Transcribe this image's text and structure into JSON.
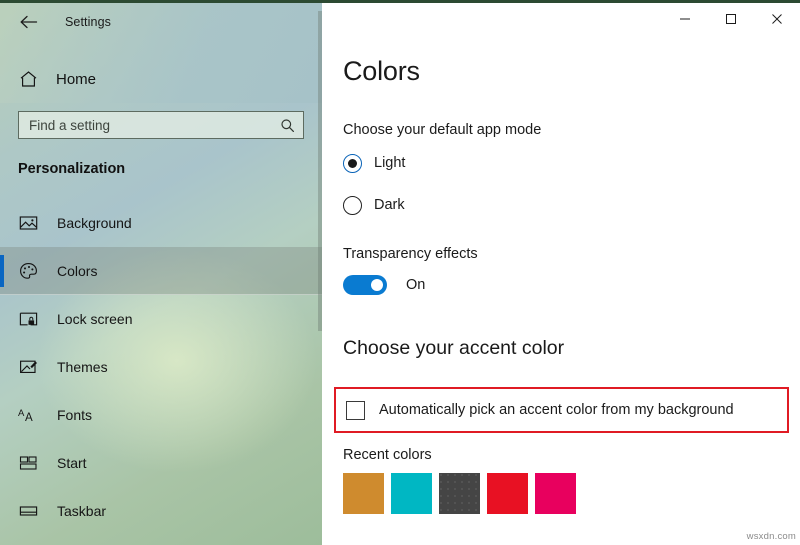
{
  "window": {
    "title": "Settings",
    "back_icon": "back-arrow-icon",
    "controls": {
      "minimize_label": "—",
      "maximize_label": "☐",
      "close_label": "✕"
    }
  },
  "sidebar": {
    "home": {
      "label": "Home",
      "icon": "home-icon"
    },
    "search": {
      "value": "",
      "placeholder": "Find a setting",
      "icon": "search-icon"
    },
    "section_title": "Personalization",
    "items": [
      {
        "label": "Background",
        "icon": "image-icon",
        "selected": false
      },
      {
        "label": "Colors",
        "icon": "palette-icon",
        "selected": true
      },
      {
        "label": "Lock screen",
        "icon": "lock-screen-icon",
        "selected": false
      },
      {
        "label": "Themes",
        "icon": "themes-brush-icon",
        "selected": false
      },
      {
        "label": "Fonts",
        "icon": "fonts-aa-icon",
        "selected": false
      },
      {
        "label": "Start",
        "icon": "start-tiles-icon",
        "selected": false
      },
      {
        "label": "Taskbar",
        "icon": "taskbar-icon",
        "selected": false
      }
    ]
  },
  "main": {
    "page_title": "Colors",
    "app_mode": {
      "label": "Choose your default app mode",
      "options": [
        {
          "label": "Light",
          "checked": true
        },
        {
          "label": "Dark",
          "checked": false
        }
      ]
    },
    "transparency": {
      "label": "Transparency effects",
      "state": "On",
      "enabled": true
    },
    "accent": {
      "heading": "Choose your accent color",
      "auto_pick_label": "Automatically pick an accent color from my background",
      "auto_pick_checked": false,
      "recent_colors_label": "Recent colors",
      "recent_colors": [
        "#CF8B2E",
        "#00B7C3",
        "#454545",
        "#E81123",
        "#E8005E"
      ]
    }
  },
  "colors": {
    "accent_blue": "#0a7bd1",
    "selection_bar": "#0a66c2",
    "highlight_border": "#e01b24",
    "radio_checked_ring": "#0a64b8"
  },
  "watermark": "wsxdn.com"
}
